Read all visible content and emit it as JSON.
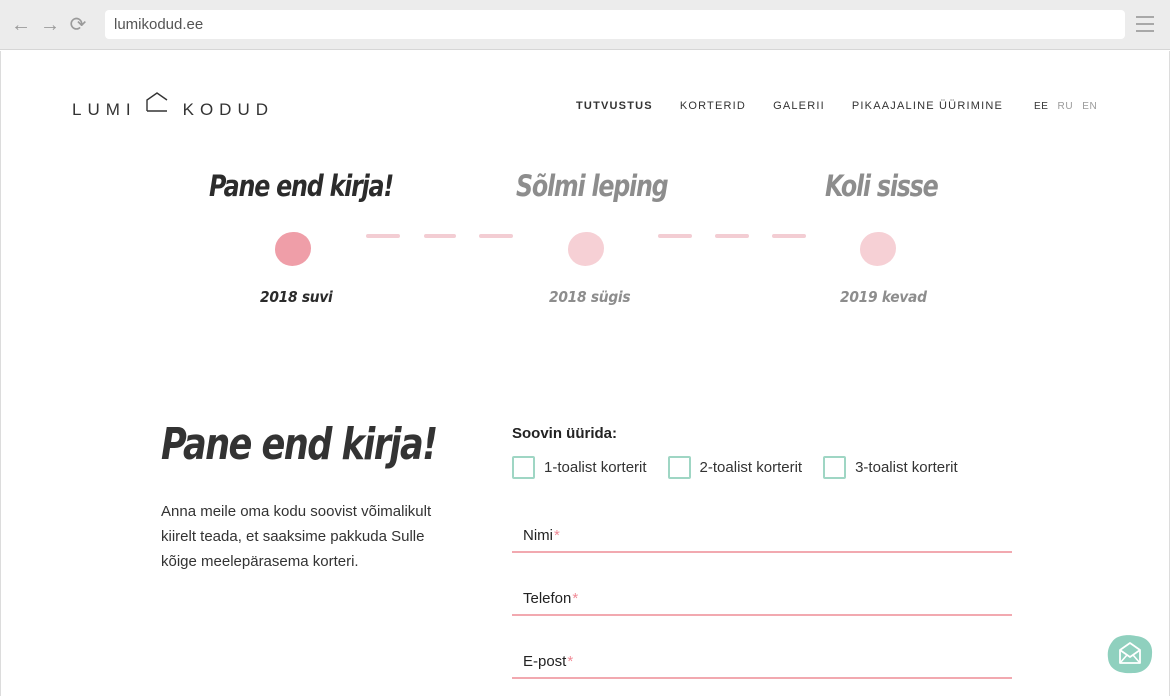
{
  "browser": {
    "url": "lumikodud.ee",
    "back_glyph": "←",
    "forward_glyph": "→",
    "reload_glyph": "⟳"
  },
  "header": {
    "logo_left": "LUMI",
    "logo_right": "KODUD",
    "nav": [
      "TUTVUSTUS",
      "KORTERID",
      "GALERII",
      "PIKAAJALINE ÜÜRIMINE"
    ],
    "active_nav": "TUTVUSTUS",
    "languages": [
      "EE",
      "RU",
      "EN"
    ],
    "active_language": "EE"
  },
  "timeline": {
    "steps": [
      {
        "title": "Pane end kirja!",
        "date": "2018 suvi",
        "active": true
      },
      {
        "title": "Sõlmi leping",
        "date": "2018 sügis",
        "active": false
      },
      {
        "title": "Koli sisse",
        "date": "2019 kevad",
        "active": false
      }
    ]
  },
  "signup": {
    "heading": "Pane end kirja!",
    "intro": "Anna meile oma kodu soovist võimalikult kiirelt teada, et saaksime pakkuda Sulle kõige meelepärasema korteri.",
    "rent_label": "Soovin üürida:",
    "options": [
      "1-toalist korterit",
      "2-toalist korterit",
      "3-toalist korterit"
    ],
    "fields": [
      {
        "label": "Nimi",
        "required_mark": "*"
      },
      {
        "label": "Telefon",
        "required_mark": "*"
      },
      {
        "label": "E-post",
        "required_mark": "*"
      }
    ]
  },
  "colors": {
    "accent_pink": "#f2a9b0",
    "active_dot": "#ef9ea8",
    "inactive_dot": "#f6d0d5",
    "checkbox_border": "#9fd6c4",
    "mail_button": "#8fd0be",
    "inactive_text": "#8d8d8d",
    "active_text": "#2b2b2b"
  },
  "icons": {
    "logo": "house-outline-icon",
    "mail": "envelope-icon",
    "menu": "hamburger-icon"
  }
}
